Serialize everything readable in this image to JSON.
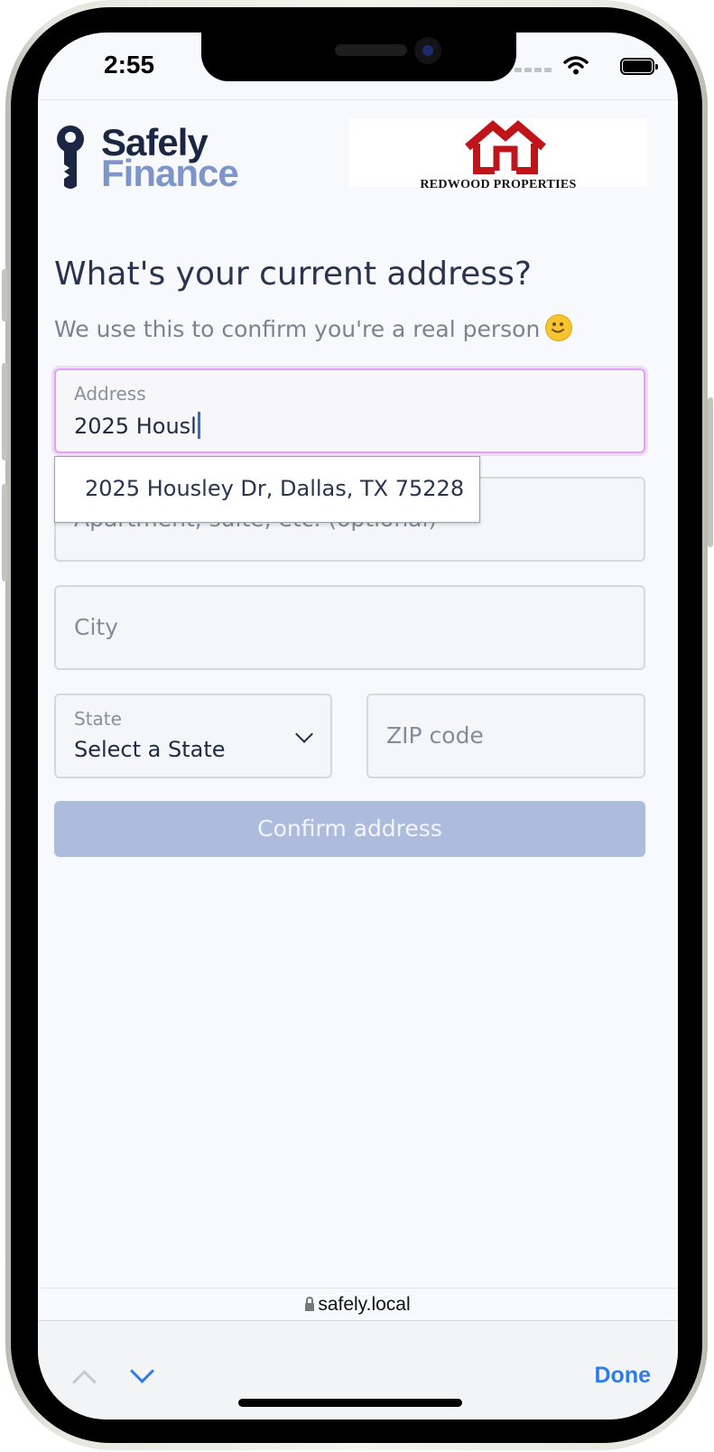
{
  "status_bar": {
    "time": "2:55"
  },
  "header": {
    "brand_line1": "Safely",
    "brand_line2": "Finance",
    "partner_name": "REDWOOD PROPERTIES"
  },
  "page": {
    "title": "What's your current address?",
    "subtitle": "We use this to confirm you're a real person"
  },
  "form": {
    "address": {
      "label": "Address",
      "value": "2025 Housl"
    },
    "apartment": {
      "placeholder": "Apartment, suite, etc. (optional)"
    },
    "city": {
      "placeholder": "City"
    },
    "state": {
      "label": "State",
      "value": "Select a State"
    },
    "zip": {
      "placeholder": "ZIP code"
    },
    "suggestion": "2025 Housley Dr, Dallas, TX 75228",
    "confirm_label": "Confirm address"
  },
  "browser": {
    "url": "safely.local"
  },
  "keyboard_bar": {
    "done_label": "Done"
  },
  "colors": {
    "brand_dark": "#1b2742",
    "brand_light": "#7e95c9",
    "partner_red": "#c0141b",
    "focus_ring": "#e0a3ef",
    "button_disabled": "#adbcdd",
    "link_blue": "#2f7bea"
  }
}
